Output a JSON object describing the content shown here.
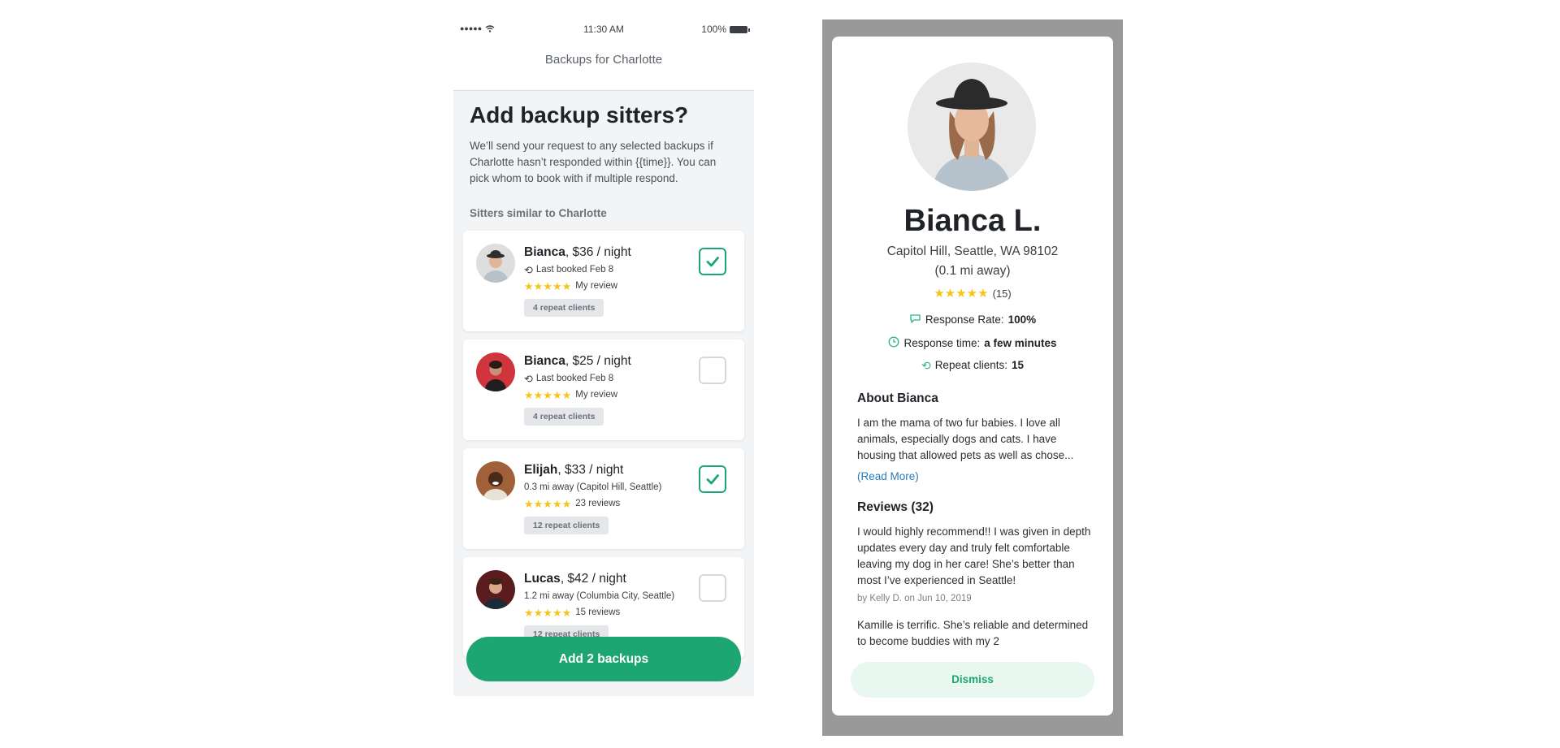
{
  "status_bar": {
    "time": "11:30 AM",
    "battery": "100%",
    "signal": "●●●●●"
  },
  "nav": {
    "title": "Backups for Charlotte"
  },
  "page": {
    "title": "Add backup sitters?",
    "description": "We’ll send your request to any selected backups if Charlotte hasn’t responded within {{time}}. You can pick whom to book with if multiple respond.",
    "section_label": "Sitters similar to Charlotte"
  },
  "sitters": [
    {
      "name": "Bianca",
      "price": ", $36 / night",
      "sub": "Last booked Feb 8",
      "sub_icon": "repeat-icon",
      "stars": "★★★★★",
      "rating_text": "My review",
      "badge": "4 repeat clients",
      "checked": true,
      "avatar_color": "#d8d8d8"
    },
    {
      "name": "Bianca",
      "price": ", $25 / night",
      "sub": "Last booked Feb 8",
      "sub_icon": "repeat-icon",
      "stars": "★★★★★",
      "rating_text": "My review",
      "badge": "4 repeat clients",
      "checked": false,
      "avatar_color": "#d0343c"
    },
    {
      "name": "Elijah",
      "price": ", $33 / night",
      "sub": "0.3 mi away (Capitol Hill, Seattle)",
      "sub_icon": "",
      "stars": "★★★★★",
      "rating_text": "23 reviews",
      "badge": "12 repeat clients",
      "checked": true,
      "avatar_color": "#8a4b2a"
    },
    {
      "name": "Lucas",
      "price": ", $42 / night",
      "sub": "1.2 mi away (Columbia City, Seattle)",
      "sub_icon": "",
      "stars": "★★★★★",
      "rating_text": "15 reviews",
      "badge": "12 repeat clients",
      "checked": false,
      "avatar_color": "#5a1c1c"
    }
  ],
  "add_button": {
    "label": "Add 2 backups"
  },
  "profile": {
    "name": "Bianca L.",
    "location": "Capitol Hill, Seattle, WA 98102",
    "distance": "(0.1 mi away)",
    "stars": "★★★★★",
    "review_count": "(15)",
    "response_rate_label": "Response Rate: ",
    "response_rate_value": "100%",
    "response_time_label": "Response time: ",
    "response_time_value": "a few minutes",
    "repeat_label": "Repeat clients: ",
    "repeat_value": "15",
    "about_heading": "About Bianca",
    "about_text": "I am the mama of two fur babies. I love all animals, especially dogs and cats. I have housing that allowed pets as well as chose...",
    "read_more": "(Read More)",
    "reviews_heading": "Reviews (32)",
    "review1_text": "I would highly recommend!! I was given in depth updates every day and truly felt comfortable leaving my dog in her care! She’s better than most I’ve experienced in Seattle!",
    "review1_by": "by Kelly D. on Jun 10, 2019",
    "review2_text": "Kamille is terrific. She’s reliable and determined to become buddies with my 2",
    "dismiss": "Dismiss"
  },
  "colors": {
    "accent": "#1ea672",
    "star": "#f5c518",
    "overlay": "#999999",
    "link": "#2a7ab8"
  }
}
